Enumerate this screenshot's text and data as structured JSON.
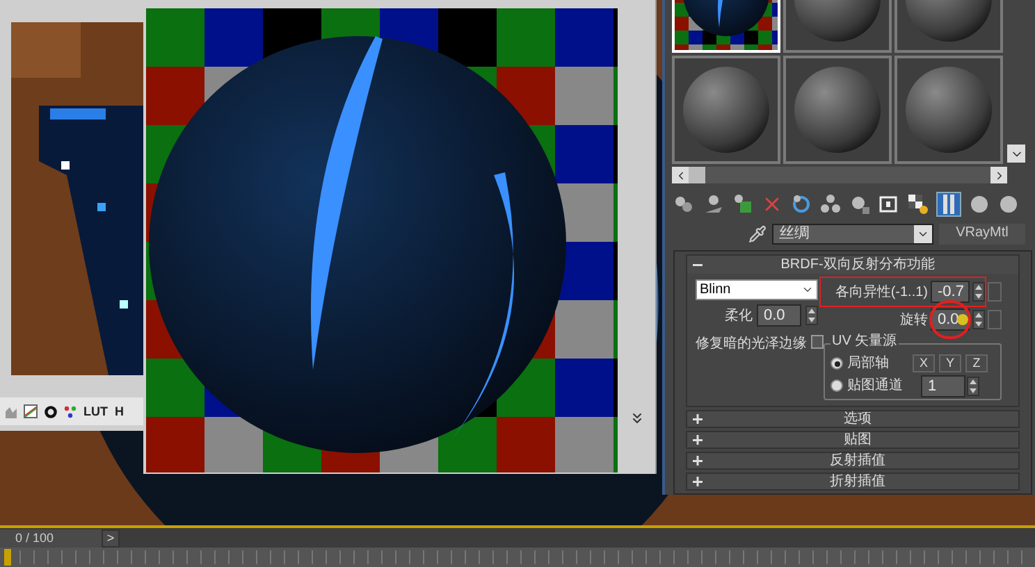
{
  "image_window": {
    "toolbar_texts": [
      "LUT",
      "H"
    ]
  },
  "material_editor": {
    "slots": [
      {
        "selected": true,
        "kind": "checker"
      },
      {
        "selected": false,
        "kind": "plain"
      },
      {
        "selected": false,
        "kind": "plain"
      },
      {
        "selected": false,
        "kind": "plain"
      },
      {
        "selected": false,
        "kind": "plain"
      },
      {
        "selected": false,
        "kind": "plain"
      }
    ],
    "viewport_toggle": {
      "on": true
    },
    "material_name": "丝绸",
    "material_type": "VRayMtl",
    "brdf": {
      "title": "BRDF-双向反射分布功能",
      "expanded": true,
      "type": "Blinn",
      "anisotropy_label": "各向异性(-1..1)",
      "anisotropy": "-0.7",
      "rotation_label": "旋转",
      "rotation": "0.0",
      "soften_label": "柔化",
      "soften": "0.0",
      "fix_dark_label": "修复暗的光泽边缘",
      "fix_dark_checked": false,
      "uv_group": "UV 矢量源",
      "uv_options": [
        {
          "label": "局部轴",
          "selected": true
        },
        {
          "label": "贴图通道",
          "selected": false
        }
      ],
      "axes": [
        "X",
        "Y",
        "Z"
      ],
      "map_channel": "1"
    },
    "rollouts": [
      {
        "title": "选项",
        "expanded": false
      },
      {
        "title": "贴图",
        "expanded": false
      },
      {
        "title": "反射插值",
        "expanded": false
      },
      {
        "title": "折射插值",
        "expanded": false
      }
    ]
  },
  "timeline": {
    "frame": "0 / 100",
    "next": ">"
  }
}
